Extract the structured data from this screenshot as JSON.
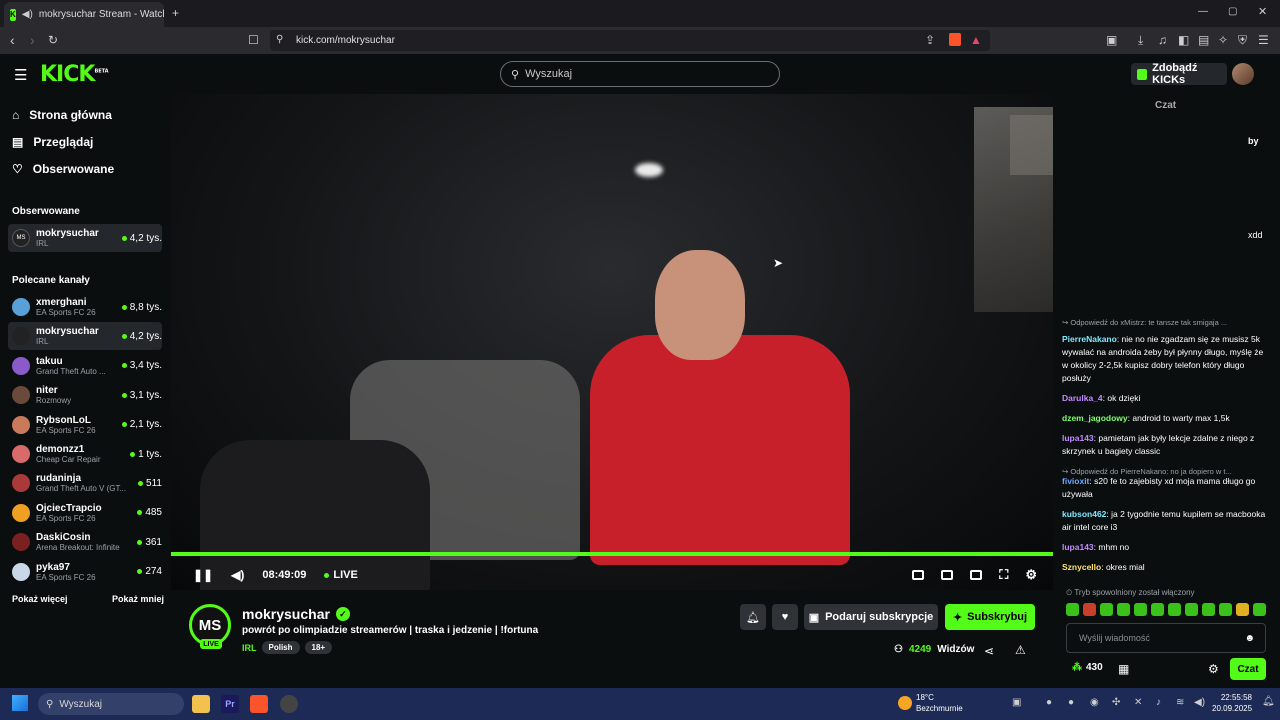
{
  "browser": {
    "tab_title": "mokrysuchar Stream - Watch",
    "url": "kick.com/mokrysuchar"
  },
  "header": {
    "logo": "KICK",
    "logo_badge": "BETA",
    "search_placeholder": "Wyszukaj",
    "kicks_button": "Zdobądź KICKs"
  },
  "sidebar": {
    "nav": [
      {
        "label": "Strona główna",
        "icon": "home-icon"
      },
      {
        "label": "Przeglądaj",
        "icon": "browse-icon"
      },
      {
        "label": "Obserwowane",
        "icon": "heart-icon"
      }
    ],
    "followed_heading": "Obserwowane",
    "followed": [
      {
        "name": "mokrysuchar",
        "category": "IRL",
        "viewers": "4,2 tys."
      }
    ],
    "recommended_heading": "Polecane kanały",
    "recommended": [
      {
        "name": "xmerghani",
        "category": "EA Sports FC 26",
        "viewers": "8,8 tys."
      },
      {
        "name": "mokrysuchar",
        "category": "IRL",
        "viewers": "4,2 tys."
      },
      {
        "name": "takuu",
        "category": "Grand Theft Auto ...",
        "viewers": "3,4 tys."
      },
      {
        "name": "niter",
        "category": "Rozmowy",
        "viewers": "3,1 tys."
      },
      {
        "name": "RybsonLoL",
        "category": "EA Sports FC 26",
        "viewers": "2,1 tys."
      },
      {
        "name": "demonzz1",
        "category": "Cheap Car Repair",
        "viewers": "1 tys."
      },
      {
        "name": "rudaninja",
        "category": "Grand Theft Auto V (GT...",
        "viewers": "511"
      },
      {
        "name": "OjciecTrapcio",
        "category": "EA Sports FC 26",
        "viewers": "485"
      },
      {
        "name": "DaskiCosin",
        "category": "Arena Breakout: Infinite",
        "viewers": "361"
      },
      {
        "name": "pyka97",
        "category": "EA Sports FC 26",
        "viewers": "274"
      }
    ],
    "show_more": "Pokaż więcej",
    "show_less": "Pokaż mniej"
  },
  "player": {
    "time": "08:49:09",
    "live_label": "LIVE"
  },
  "stream": {
    "avatar_text": "MS",
    "live_badge": "LIVE",
    "channel": "mokrysuchar",
    "title": "powrót po olimpiadzie streamerów | traska i jedzenie | !fortuna",
    "category": "IRL",
    "tags": [
      "Polish",
      "18+"
    ],
    "gift_button": "Podaruj subskrypcje",
    "subscribe_button": "Subskrybuj",
    "viewers": "4249",
    "viewers_label": "Widzów"
  },
  "chat": {
    "partial_header": "Czat",
    "partial_by": "by",
    "partial_xdd": "xdd",
    "messages": [
      {
        "reply": "Odpowiedź do xMistrz: te tansze tak smigaja ...",
        "user": "",
        "text": "",
        "color": "#ffffff"
      },
      {
        "reply": "",
        "user": "PierreNakano",
        "text": "nie no nie zgadzam się ze musisz 5k wywalać na androida żeby był płynny długo, myślę że w okolicy 2-2,5k kupisz dobry telefon który długo posłuży",
        "color": "#7fe8ff"
      },
      {
        "reply": "",
        "user": "Darulka_4",
        "text": "ok dzięki",
        "color": "#c38bff"
      },
      {
        "reply": "",
        "user": "dzem_jagodowy",
        "text": "android to warty max 1,5k",
        "color": "#7dff6b"
      },
      {
        "reply": "",
        "user": "lupa143",
        "text": "pamietam jak były lekcje zdalne z niego z skrzynek u bagiety classic",
        "color": "#c38bff"
      },
      {
        "reply": "Odpowiedź do PierreNakano: no ja dopiero w t...",
        "user": "fivioxit",
        "text": "s20 fe to zajebisty xd moja mama długo go używała",
        "color": "#6ea8ff"
      },
      {
        "reply": "",
        "user": "kubson462",
        "text": "ja 2 tygodnie temu kupilem se macbooka air intel core i3",
        "color": "#7fe8ff"
      },
      {
        "reply": "",
        "user": "lupa143",
        "text": "mhm no",
        "color": "#c38bff"
      },
      {
        "reply": "",
        "user": "Sznycello",
        "text": "okres mial",
        "color": "#ffe36e"
      }
    ],
    "slow_mode": "Tryb spowolniony został włączony",
    "input_placeholder": "Wyślij wiadomość",
    "points": "430",
    "send_button": "Czat"
  },
  "taskbar": {
    "search": "Wyszukaj",
    "weather_temp": "18°C",
    "weather_desc": "Bezchmurnie",
    "time": "22:55:58",
    "date": "20.09.2025"
  },
  "colors": {
    "accent": "#53fc18",
    "background": "#0b0e0f",
    "panel": "#24272c"
  }
}
